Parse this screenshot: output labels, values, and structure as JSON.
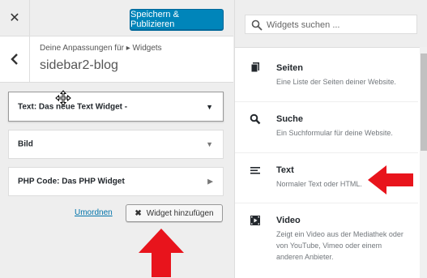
{
  "topbar": {
    "close_glyph": "✕",
    "publish_label": "Speichern & Publizieren"
  },
  "section": {
    "back_glyph": "‹",
    "breadcrumb": "Deine Anpassungen für ▸ Widgets",
    "title": "sidebar2-blog"
  },
  "widgets": [
    {
      "title": "Text: Das neue Text Widget -",
      "arrow": "▼"
    },
    {
      "title": "Bild",
      "arrow": "▼"
    },
    {
      "title": "PHP Code: Das PHP Widget",
      "arrow": "▶"
    }
  ],
  "actions": {
    "reorder_label": "Umordnen",
    "add_widget_label": "Widget hinzufügen",
    "add_glyph": "✖"
  },
  "chooser": {
    "search_placeholder": "Widgets suchen ...",
    "items": [
      {
        "name": "Seiten",
        "desc": "Eine Liste der Seiten deiner Website.",
        "icon": "pages-icon"
      },
      {
        "name": "Suche",
        "desc": "Ein Suchformular für deine Website.",
        "icon": "search-icon"
      },
      {
        "name": "Text",
        "desc": "Normaler Text oder HTML.",
        "icon": "text-lines-icon"
      },
      {
        "name": "Video",
        "desc": "Zeigt ein Video aus der Mediathek oder von YouTube, Vimeo oder einem anderen Anbieter.",
        "icon": "video-icon"
      }
    ]
  },
  "colors": {
    "primary_button": "#0085ba",
    "annotation_arrow": "#e8141c",
    "link": "#0073aa"
  }
}
